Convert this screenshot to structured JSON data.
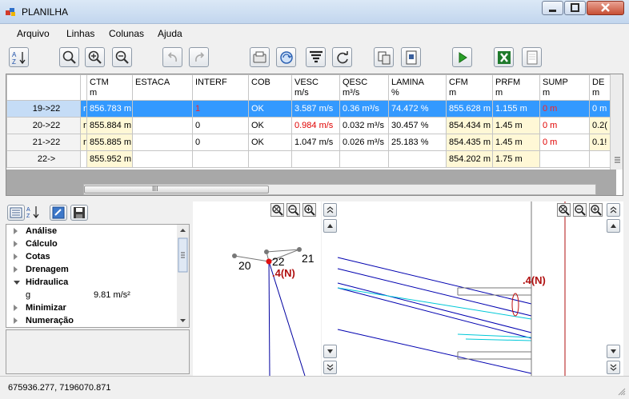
{
  "window": {
    "title": "PLANILHA"
  },
  "menu": [
    "Arquivo",
    "Linhas",
    "Colunas",
    "Ajuda"
  ],
  "grid": {
    "headers": [
      {
        "name": "",
        "unit": ""
      },
      {
        "name": "CTM",
        "unit": "m"
      },
      {
        "name": "ESTACA",
        "unit": ""
      },
      {
        "name": "INTERF",
        "unit": ""
      },
      {
        "name": "COB",
        "unit": ""
      },
      {
        "name": "VESC",
        "unit": "m/s"
      },
      {
        "name": "QESC",
        "unit": "m³/s"
      },
      {
        "name": "LAMINA",
        "unit": "%"
      },
      {
        "name": "CFM",
        "unit": "m"
      },
      {
        "name": "PRFM",
        "unit": "m"
      },
      {
        "name": "SUMP",
        "unit": "m"
      },
      {
        "name": "DE",
        "unit": "m"
      }
    ],
    "rows": [
      {
        "id": "19->22",
        "pre": "n",
        "ctm": "856.783 m",
        "estaca": "",
        "interf": "1",
        "cob": "OK",
        "vesc": "3.587 m/s",
        "qesc": "0.36 m³/s",
        "lamina": "74.472 %",
        "cfm": "855.628 m",
        "prfm": "1.155 m",
        "sump": "0 m",
        "de": "0 m"
      },
      {
        "id": "20->22",
        "pre": "n",
        "ctm": "855.884 m",
        "estaca": "",
        "interf": "0",
        "cob": "OK",
        "vesc": "0.984 m/s",
        "qesc": "0.032 m³/s",
        "lamina": "30.457 %",
        "cfm": "854.434 m",
        "prfm": "1.45 m",
        "sump": "0 m",
        "de": "0.2("
      },
      {
        "id": "21->22",
        "pre": "n",
        "ctm": "855.885 m",
        "estaca": "",
        "interf": "0",
        "cob": "OK",
        "vesc": "1.047 m/s",
        "qesc": "0.026 m³/s",
        "lamina": "25.183 %",
        "cfm": "854.435 m",
        "prfm": "1.45 m",
        "sump": "0 m",
        "de": "0.1!"
      },
      {
        "id": "22->",
        "pre": "",
        "ctm": "855.952 m",
        "estaca": "",
        "interf": "",
        "cob": "",
        "vesc": "",
        "qesc": "",
        "lamina": "",
        "cfm": "854.202 m",
        "prfm": "1.75 m",
        "sump": "",
        "de": ""
      }
    ],
    "hscroll_marker": "III"
  },
  "properties": {
    "items": [
      {
        "label": "Análise",
        "open": false
      },
      {
        "label": "Cálculo",
        "open": false
      },
      {
        "label": "Cotas",
        "open": false
      },
      {
        "label": "Drenagem",
        "open": false
      },
      {
        "label": "Hidraulica",
        "open": true
      },
      {
        "label": "Minimizar",
        "open": false
      },
      {
        "label": "Numeração",
        "open": false
      }
    ],
    "g_label": "g",
    "g_value": "9.81 m/s²"
  },
  "view1": {
    "n20": "20",
    "n22": "22",
    "n21": "21",
    "tag": ".4(N)"
  },
  "view2": {
    "tag": ".4(N)"
  },
  "status": {
    "coords": "675936.277, 7196070.871"
  }
}
